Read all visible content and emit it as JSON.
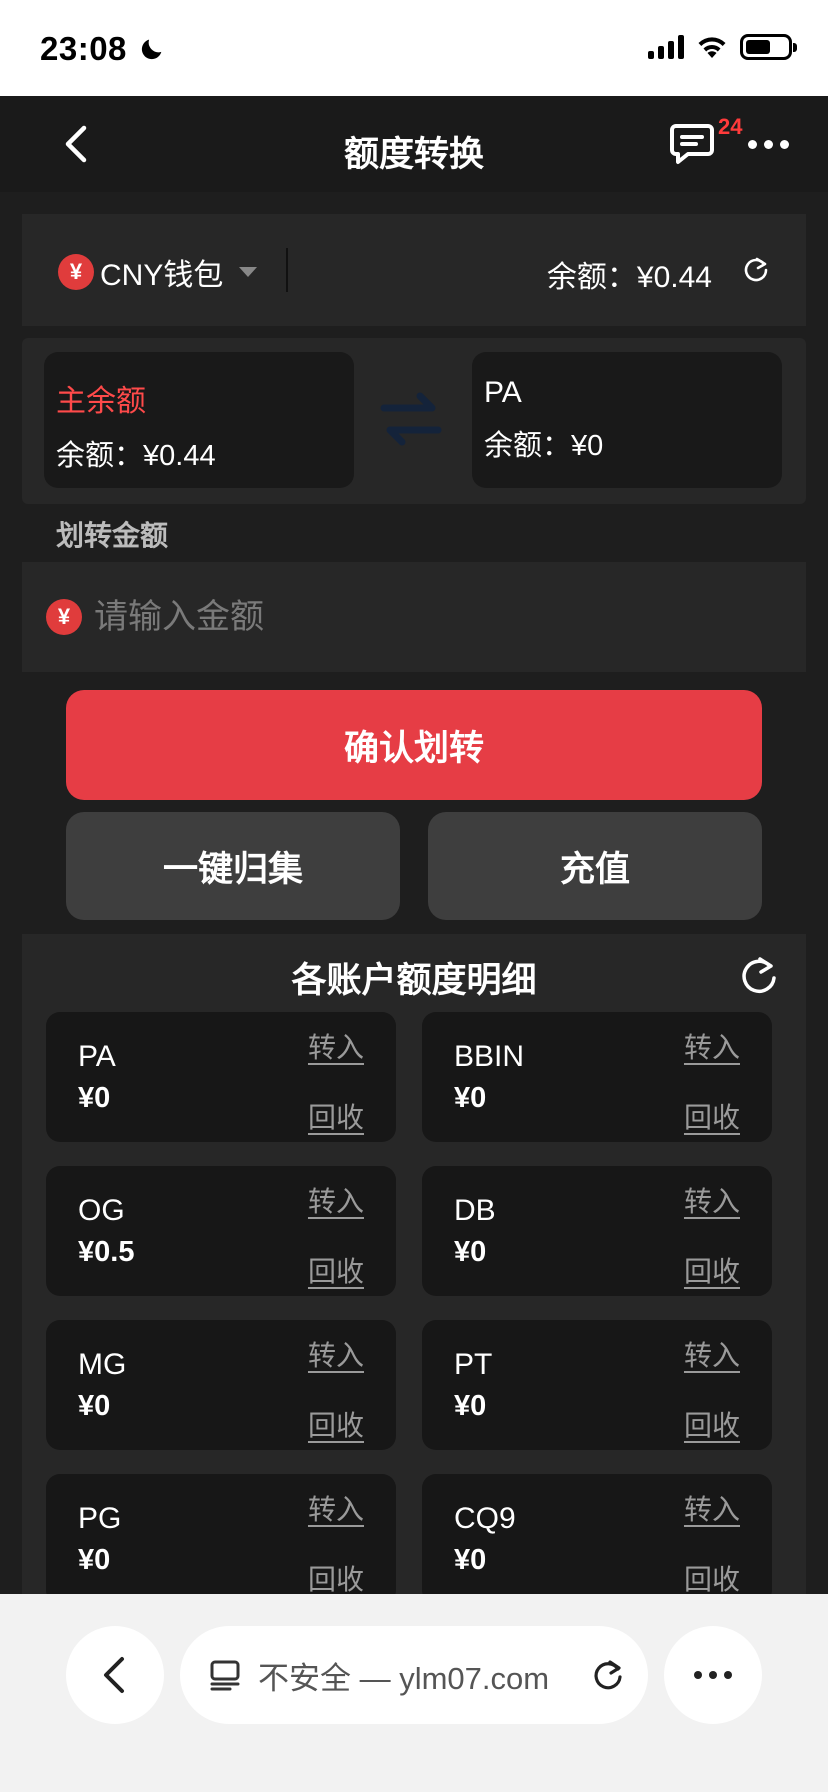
{
  "status_bar": {
    "time": "23:08"
  },
  "header": {
    "title": "额度转换",
    "message_badge": "24"
  },
  "wallet": {
    "currency_symbol": "¥",
    "name": "CNY钱包",
    "balance_label": "余额：¥0.44"
  },
  "transfer": {
    "from": {
      "name": "主余额",
      "balance": "余额：¥0.44"
    },
    "to": {
      "name": "PA",
      "balance": "余额：¥0"
    },
    "amount_label": "划转金额",
    "amount_placeholder": "请输入金额",
    "currency_symbol": "¥"
  },
  "buttons": {
    "confirm": "确认划转",
    "collect": "一键归集",
    "recharge": "充值"
  },
  "details": {
    "title": "各账户额度明细",
    "in_label": "转入",
    "out_label": "回收",
    "accounts": [
      {
        "name": "PA",
        "balance": "¥0"
      },
      {
        "name": "BBIN",
        "balance": "¥0"
      },
      {
        "name": "OG",
        "balance": "¥0.5"
      },
      {
        "name": "DB",
        "balance": "¥0"
      },
      {
        "name": "MG",
        "balance": "¥0"
      },
      {
        "name": "PT",
        "balance": "¥0"
      },
      {
        "name": "PG",
        "balance": "¥0"
      },
      {
        "name": "CQ9",
        "balance": "¥0"
      }
    ]
  },
  "browser": {
    "url_text": "不安全 — ylm07.com"
  },
  "colors": {
    "accent": "#e63d45",
    "danger_text": "#ff4a4a",
    "card_bg": "#272727"
  }
}
